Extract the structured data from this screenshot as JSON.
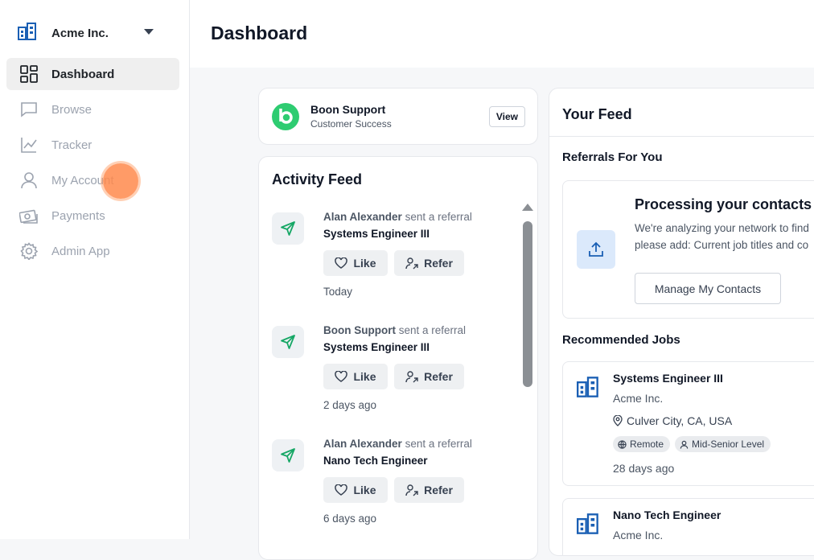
{
  "sidebar": {
    "org_name": "Acme Inc.",
    "items": [
      {
        "label": "Dashboard",
        "icon": "dashboard-grid-icon",
        "active": true
      },
      {
        "label": "Browse",
        "icon": "chat-bubble-icon",
        "active": false
      },
      {
        "label": "Tracker",
        "icon": "line-chart-icon",
        "active": false
      },
      {
        "label": "My Account",
        "icon": "user-icon",
        "active": false
      },
      {
        "label": "Payments",
        "icon": "money-bills-icon",
        "active": false
      },
      {
        "label": "Admin App",
        "icon": "gear-icon",
        "active": false
      }
    ]
  },
  "header": {
    "title": "Dashboard"
  },
  "support_card": {
    "name": "Boon Support",
    "team": "Customer Success",
    "view_label": "View"
  },
  "activity": {
    "title": "Activity Feed",
    "items": [
      {
        "actor": "Alan Alexander",
        "action": "sent a referral",
        "job": "Systems Engineer III",
        "time": "Today"
      },
      {
        "actor": "Boon Support",
        "action": "sent a referral",
        "job": "Systems Engineer III",
        "time": "2 days ago"
      },
      {
        "actor": "Alan Alexander",
        "action": "sent a referral",
        "job": "Nano Tech Engineer",
        "time": "6 days ago"
      }
    ],
    "like_label": "Like",
    "refer_label": "Refer"
  },
  "feed": {
    "title": "Your Feed",
    "referrals_title": "Referrals For You",
    "processing": {
      "title": "Processing your contacts",
      "line1": "We're analyzing your network to find",
      "line2": "please add: Current job titles and co",
      "button": "Manage My Contacts"
    },
    "recommended_title": "Recommended Jobs",
    "jobs": [
      {
        "title": "Systems Engineer III",
        "company": "Acme Inc.",
        "location": "Culver City, CA, USA",
        "tags": [
          "Remote",
          "Mid-Senior Level"
        ],
        "posted": "28 days ago"
      },
      {
        "title": "Nano Tech Engineer",
        "company": "Acme Inc."
      }
    ]
  },
  "colors": {
    "brand_green": "#2ecc71",
    "accent_blue": "#1a5fb4",
    "feed_icon_green": "#16a765"
  }
}
